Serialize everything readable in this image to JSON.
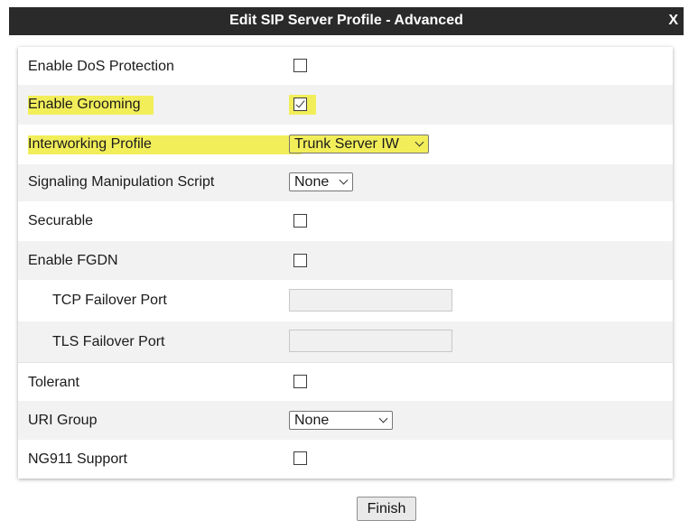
{
  "dialog": {
    "title": "Edit SIP Server Profile - Advanced",
    "close_label": "X"
  },
  "rows": {
    "dos": {
      "label": "Enable DoS Protection",
      "checked": false
    },
    "grooming": {
      "label": "Enable Grooming",
      "checked": true,
      "highlighted": true
    },
    "interworking": {
      "label": "Interworking Profile",
      "value": "Trunk Server IW",
      "highlighted": true
    },
    "signaling": {
      "label": "Signaling Manipulation Script",
      "value": "None"
    },
    "securable": {
      "label": "Securable",
      "checked": false
    },
    "fgdn": {
      "label": "Enable FGDN",
      "checked": false
    },
    "tcp_failover": {
      "label": "TCP Failover Port",
      "value": ""
    },
    "tls_failover": {
      "label": "TLS Failover Port",
      "value": ""
    },
    "tolerant": {
      "label": "Tolerant",
      "checked": false
    },
    "uri_group": {
      "label": "URI Group",
      "value": "None"
    },
    "ng911": {
      "label": "NG911 Support",
      "checked": false
    }
  },
  "footer": {
    "finish_label": "Finish"
  },
  "colors": {
    "highlight": "#f2ee5a",
    "titlebar": "#2a2a2a",
    "row_alt": "#f2f2f2"
  }
}
